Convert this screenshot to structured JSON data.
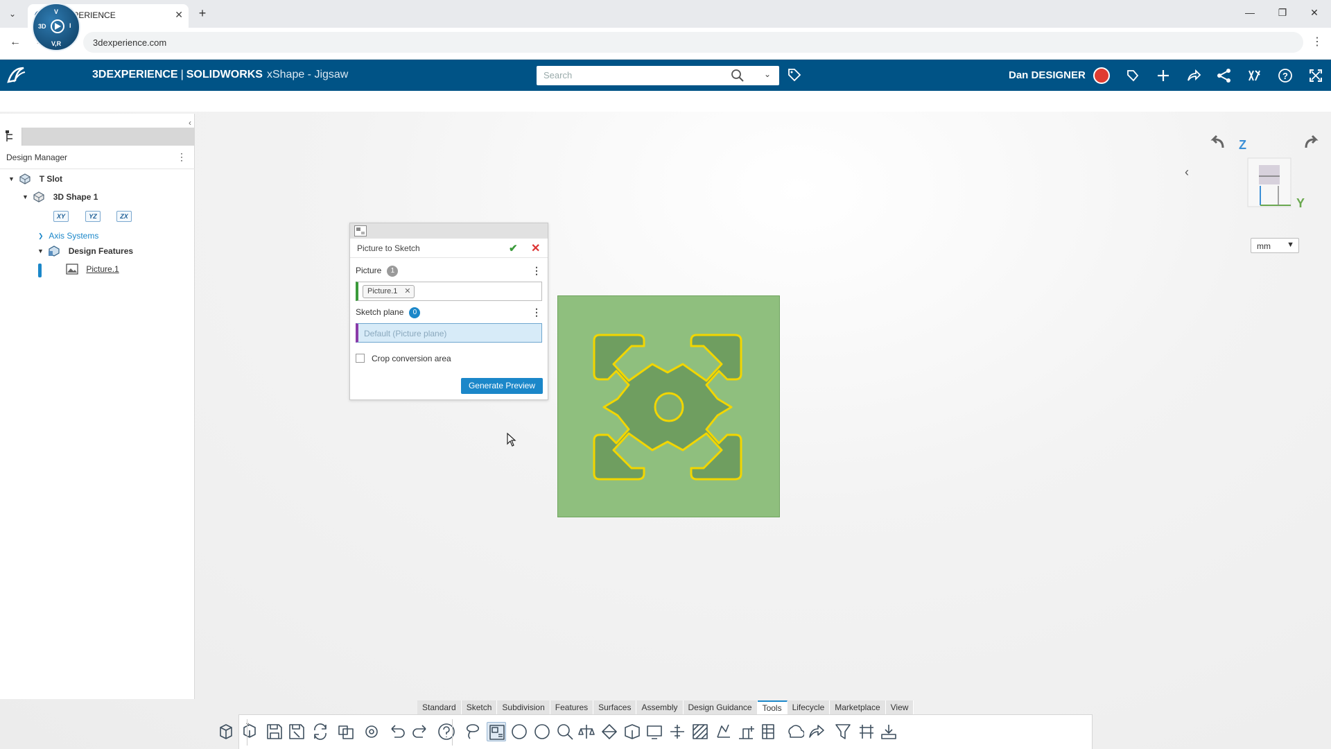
{
  "browser": {
    "tab_title": "3DEXPERIENCE",
    "url": "3dexperience.com"
  },
  "header": {
    "brand": "3DEXPERIENCE",
    "separator": "|",
    "product": "SOLIDWORKS",
    "app": "xShape - Jigsaw",
    "search_placeholder": "Search",
    "user_name": "Dan DESIGNER",
    "compass_labels": {
      "top": "V",
      "left": "3D",
      "right": "I",
      "bottom": "V,R"
    }
  },
  "design_manager": {
    "title": "Design Manager",
    "tree": {
      "root": "T Slot",
      "shape": "3D Shape 1",
      "planes": [
        "XY",
        "YZ",
        "ZX"
      ],
      "axis_systems": "Axis Systems",
      "design_features": "Design Features",
      "picture": "Picture.1"
    }
  },
  "dialog": {
    "title": "Picture to Sketch",
    "picture_label": "Picture",
    "picture_count": "1",
    "picture_value": "Picture.1",
    "plane_label": "Sketch plane",
    "plane_count": "0",
    "plane_placeholder": "Default (Picture plane)",
    "crop_label": "Crop conversion area",
    "crop_checked": false,
    "generate_label": "Generate Preview"
  },
  "view": {
    "axis_z": "Z",
    "axis_y": "Y",
    "units": "mm"
  },
  "section_tabs": [
    "Standard",
    "Sketch",
    "Subdivision",
    "Features",
    "Surfaces",
    "Assembly",
    "Design Guidance",
    "Tools",
    "Lifecycle",
    "Marketplace",
    "View"
  ],
  "active_section": "Tools",
  "colors": {
    "header_bg": "#005386",
    "accent": "#1b87c9",
    "picture_bg": "#8fbf7e",
    "outline": "#f2d600"
  }
}
